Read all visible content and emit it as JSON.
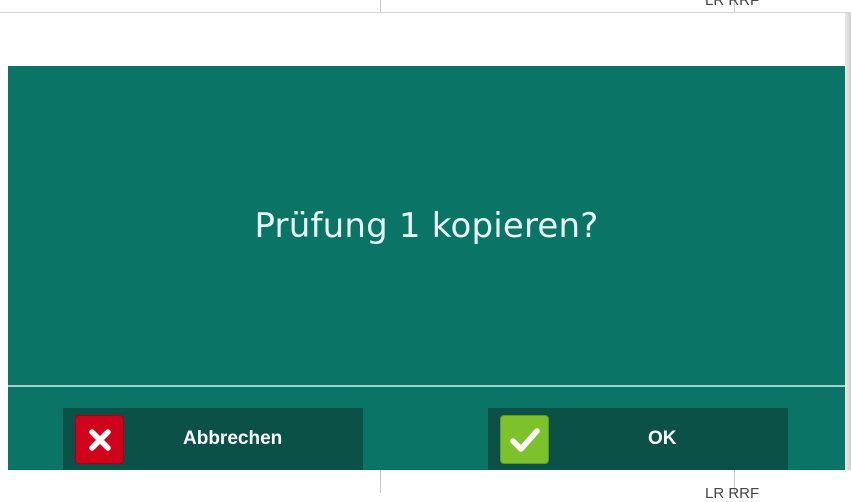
{
  "background": {
    "top_text": "LR  RRF",
    "bottom_text": "LR  RRF"
  },
  "dialog": {
    "message": "Prüfung 1 kopieren?",
    "colors": {
      "panel": "#0a7467",
      "button": "#0b5147",
      "cancel_icon": "#d0021b",
      "ok_icon": "#7ec22b"
    },
    "buttons": {
      "cancel": {
        "label": "Abbrechen",
        "icon": "close-icon"
      },
      "ok": {
        "label": "OK",
        "icon": "check-icon"
      }
    }
  }
}
